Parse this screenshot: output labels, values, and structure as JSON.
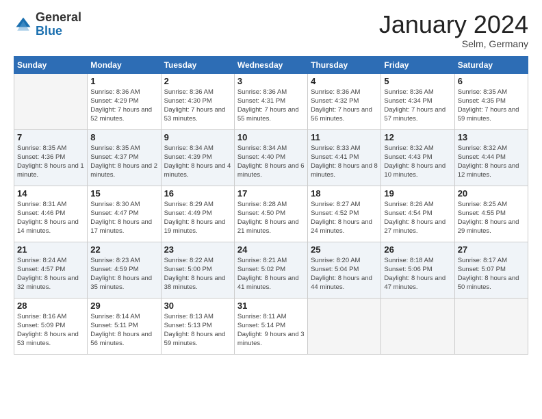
{
  "logo": {
    "general": "General",
    "blue": "Blue"
  },
  "title": "January 2024",
  "subtitle": "Selm, Germany",
  "days_header": [
    "Sunday",
    "Monday",
    "Tuesday",
    "Wednesday",
    "Thursday",
    "Friday",
    "Saturday"
  ],
  "weeks": [
    [
      {
        "day": "",
        "empty": true
      },
      {
        "day": "1",
        "sunrise": "Sunrise: 8:36 AM",
        "sunset": "Sunset: 4:29 PM",
        "daylight": "Daylight: 7 hours and 52 minutes."
      },
      {
        "day": "2",
        "sunrise": "Sunrise: 8:36 AM",
        "sunset": "Sunset: 4:30 PM",
        "daylight": "Daylight: 7 hours and 53 minutes."
      },
      {
        "day": "3",
        "sunrise": "Sunrise: 8:36 AM",
        "sunset": "Sunset: 4:31 PM",
        "daylight": "Daylight: 7 hours and 55 minutes."
      },
      {
        "day": "4",
        "sunrise": "Sunrise: 8:36 AM",
        "sunset": "Sunset: 4:32 PM",
        "daylight": "Daylight: 7 hours and 56 minutes."
      },
      {
        "day": "5",
        "sunrise": "Sunrise: 8:36 AM",
        "sunset": "Sunset: 4:34 PM",
        "daylight": "Daylight: 7 hours and 57 minutes."
      },
      {
        "day": "6",
        "sunrise": "Sunrise: 8:35 AM",
        "sunset": "Sunset: 4:35 PM",
        "daylight": "Daylight: 7 hours and 59 minutes."
      }
    ],
    [
      {
        "day": "7",
        "sunrise": "Sunrise: 8:35 AM",
        "sunset": "Sunset: 4:36 PM",
        "daylight": "Daylight: 8 hours and 1 minute."
      },
      {
        "day": "8",
        "sunrise": "Sunrise: 8:35 AM",
        "sunset": "Sunset: 4:37 PM",
        "daylight": "Daylight: 8 hours and 2 minutes."
      },
      {
        "day": "9",
        "sunrise": "Sunrise: 8:34 AM",
        "sunset": "Sunset: 4:39 PM",
        "daylight": "Daylight: 8 hours and 4 minutes."
      },
      {
        "day": "10",
        "sunrise": "Sunrise: 8:34 AM",
        "sunset": "Sunset: 4:40 PM",
        "daylight": "Daylight: 8 hours and 6 minutes."
      },
      {
        "day": "11",
        "sunrise": "Sunrise: 8:33 AM",
        "sunset": "Sunset: 4:41 PM",
        "daylight": "Daylight: 8 hours and 8 minutes."
      },
      {
        "day": "12",
        "sunrise": "Sunrise: 8:32 AM",
        "sunset": "Sunset: 4:43 PM",
        "daylight": "Daylight: 8 hours and 10 minutes."
      },
      {
        "day": "13",
        "sunrise": "Sunrise: 8:32 AM",
        "sunset": "Sunset: 4:44 PM",
        "daylight": "Daylight: 8 hours and 12 minutes."
      }
    ],
    [
      {
        "day": "14",
        "sunrise": "Sunrise: 8:31 AM",
        "sunset": "Sunset: 4:46 PM",
        "daylight": "Daylight: 8 hours and 14 minutes."
      },
      {
        "day": "15",
        "sunrise": "Sunrise: 8:30 AM",
        "sunset": "Sunset: 4:47 PM",
        "daylight": "Daylight: 8 hours and 17 minutes."
      },
      {
        "day": "16",
        "sunrise": "Sunrise: 8:29 AM",
        "sunset": "Sunset: 4:49 PM",
        "daylight": "Daylight: 8 hours and 19 minutes."
      },
      {
        "day": "17",
        "sunrise": "Sunrise: 8:28 AM",
        "sunset": "Sunset: 4:50 PM",
        "daylight": "Daylight: 8 hours and 21 minutes."
      },
      {
        "day": "18",
        "sunrise": "Sunrise: 8:27 AM",
        "sunset": "Sunset: 4:52 PM",
        "daylight": "Daylight: 8 hours and 24 minutes."
      },
      {
        "day": "19",
        "sunrise": "Sunrise: 8:26 AM",
        "sunset": "Sunset: 4:54 PM",
        "daylight": "Daylight: 8 hours and 27 minutes."
      },
      {
        "day": "20",
        "sunrise": "Sunrise: 8:25 AM",
        "sunset": "Sunset: 4:55 PM",
        "daylight": "Daylight: 8 hours and 29 minutes."
      }
    ],
    [
      {
        "day": "21",
        "sunrise": "Sunrise: 8:24 AM",
        "sunset": "Sunset: 4:57 PM",
        "daylight": "Daylight: 8 hours and 32 minutes."
      },
      {
        "day": "22",
        "sunrise": "Sunrise: 8:23 AM",
        "sunset": "Sunset: 4:59 PM",
        "daylight": "Daylight: 8 hours and 35 minutes."
      },
      {
        "day": "23",
        "sunrise": "Sunrise: 8:22 AM",
        "sunset": "Sunset: 5:00 PM",
        "daylight": "Daylight: 8 hours and 38 minutes."
      },
      {
        "day": "24",
        "sunrise": "Sunrise: 8:21 AM",
        "sunset": "Sunset: 5:02 PM",
        "daylight": "Daylight: 8 hours and 41 minutes."
      },
      {
        "day": "25",
        "sunrise": "Sunrise: 8:20 AM",
        "sunset": "Sunset: 5:04 PM",
        "daylight": "Daylight: 8 hours and 44 minutes."
      },
      {
        "day": "26",
        "sunrise": "Sunrise: 8:18 AM",
        "sunset": "Sunset: 5:06 PM",
        "daylight": "Daylight: 8 hours and 47 minutes."
      },
      {
        "day": "27",
        "sunrise": "Sunrise: 8:17 AM",
        "sunset": "Sunset: 5:07 PM",
        "daylight": "Daylight: 8 hours and 50 minutes."
      }
    ],
    [
      {
        "day": "28",
        "sunrise": "Sunrise: 8:16 AM",
        "sunset": "Sunset: 5:09 PM",
        "daylight": "Daylight: 8 hours and 53 minutes."
      },
      {
        "day": "29",
        "sunrise": "Sunrise: 8:14 AM",
        "sunset": "Sunset: 5:11 PM",
        "daylight": "Daylight: 8 hours and 56 minutes."
      },
      {
        "day": "30",
        "sunrise": "Sunrise: 8:13 AM",
        "sunset": "Sunset: 5:13 PM",
        "daylight": "Daylight: 8 hours and 59 minutes."
      },
      {
        "day": "31",
        "sunrise": "Sunrise: 8:11 AM",
        "sunset": "Sunset: 5:14 PM",
        "daylight": "Daylight: 9 hours and 3 minutes."
      },
      {
        "day": "",
        "empty": true
      },
      {
        "day": "",
        "empty": true
      },
      {
        "day": "",
        "empty": true
      }
    ]
  ]
}
